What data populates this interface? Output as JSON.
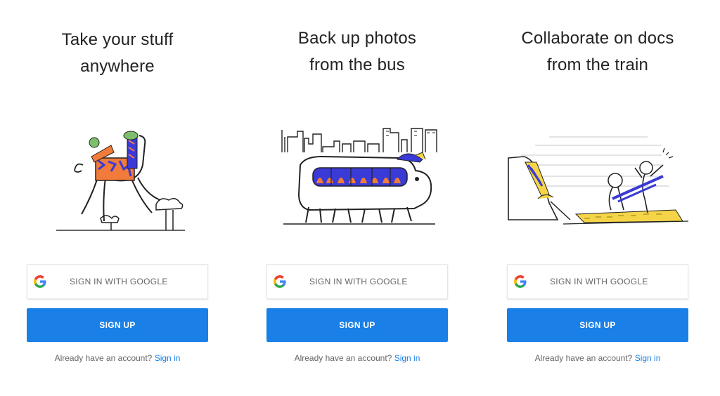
{
  "panels": [
    {
      "title_line1": "Take your stuff",
      "title_line2": "anywhere",
      "illustration": "giraffe-carrying-box",
      "google_button_label": "SIGN IN WITH GOOGLE",
      "google_icon": "google-g-icon",
      "signup_label": "SIGN UP",
      "account_prompt": "Already have an account?",
      "signin_link": "Sign in"
    },
    {
      "title_line1": "Back up photos",
      "title_line2": "from the bus",
      "illustration": "bus-creature-city",
      "google_button_label": "SIGN IN WITH GOOGLE",
      "google_icon": "google-g-icon",
      "signup_label": "SIGN UP",
      "account_prompt": "Already have an account?",
      "signin_link": "Sign in"
    },
    {
      "title_line1": "Collaborate on docs",
      "title_line2": "from the train",
      "illustration": "people-on-train-platform",
      "google_button_label": "SIGN IN WITH GOOGLE",
      "google_icon": "google-g-icon",
      "signup_label": "SIGN UP",
      "account_prompt": "Already have an account?",
      "signin_link": "Sign in"
    }
  ],
  "colors": {
    "primary": "#1a7fe6",
    "illustration_blue": "#3a3ad6",
    "illustration_orange": "#f07b3a",
    "illustration_yellow": "#f5d547"
  }
}
